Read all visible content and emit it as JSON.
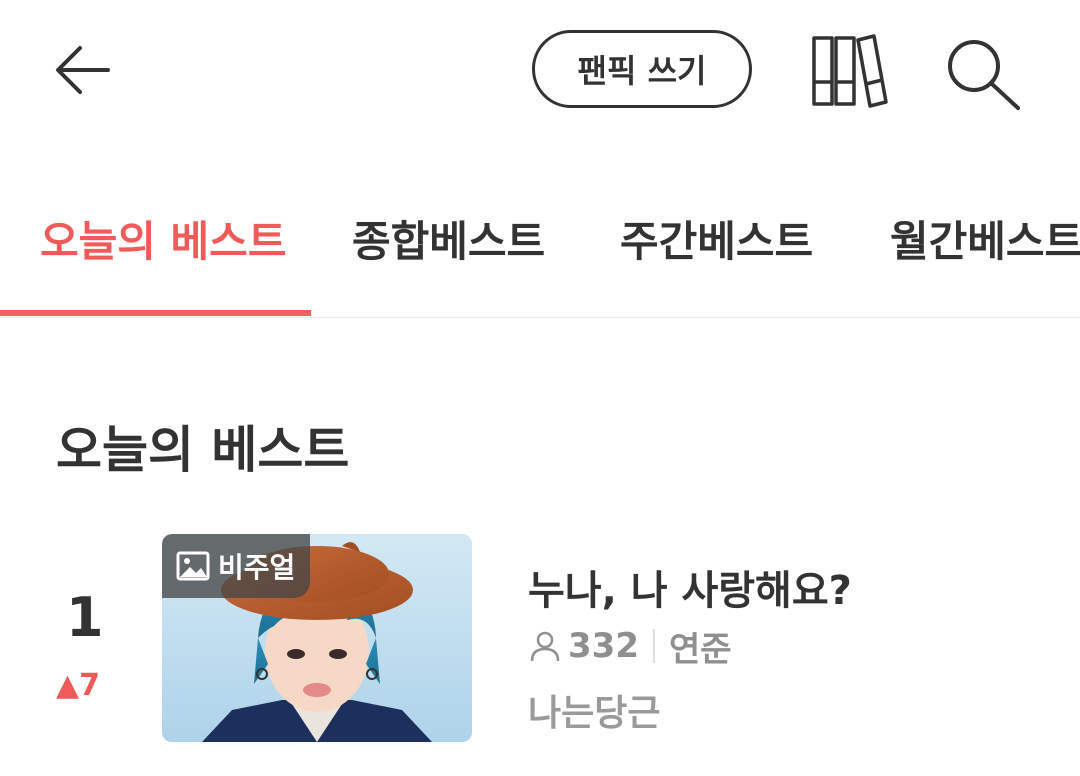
{
  "header": {
    "write_button_label": "팬픽 쓰기"
  },
  "tabs": [
    {
      "label": "오늘의 베스트",
      "active": true
    },
    {
      "label": "종합베스트",
      "active": false
    },
    {
      "label": "주간베스트",
      "active": false
    },
    {
      "label": "월간베스트",
      "active": false
    }
  ],
  "section": {
    "title": "오늘의 베스트"
  },
  "ranking": [
    {
      "rank": "1",
      "change": "▲7",
      "badge": "비주얼",
      "title": "누나, 나 사랑해요?",
      "views": "332",
      "character": "연준",
      "author": "나는당근"
    }
  ],
  "colors": {
    "accent": "#f05a5a",
    "text": "#333333",
    "muted": "#8f8f8f"
  }
}
